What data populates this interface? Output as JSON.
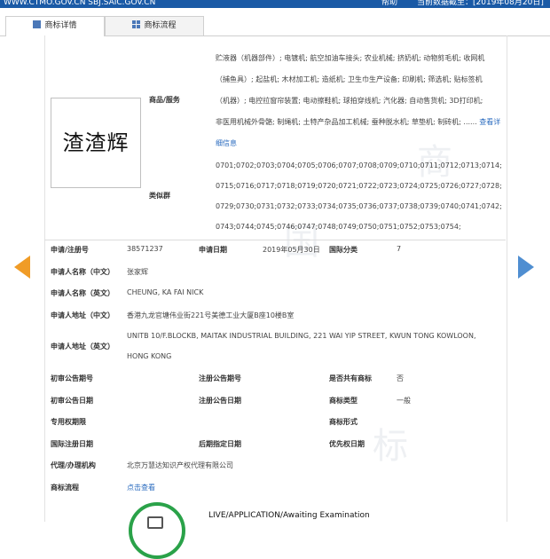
{
  "topbar": {
    "site": "WWW.CTMO.GOV.CN SBJ.SAIC.GOV.CN",
    "help": "帮助",
    "data_date": "当前数据截至：[2019年08月20日]"
  },
  "tabs": [
    {
      "label": "商标详情",
      "icon": "document-icon"
    },
    {
      "label": "商标流程",
      "icon": "grid-icon"
    }
  ],
  "trademark": {
    "logo_text": "渣渣辉",
    "goods_label": "商品/服务",
    "goods_lines": [
      "贮液器（机器部件）; 电镀机; 航空加油车接头; 农业机械; 挤奶机; 动物剪毛机; 收网机",
      "（捕鱼具）; 起盐机; 木材加工机; 造纸机; 卫生巾生产设备; 印刷机; 筛选机; 贴标签机",
      "（机器）; 电控拉窗帘装置; 电动擦鞋机; 球拍穿线机; 汽化器; 自动售货机; 3D打印机;",
      "非医用机械外骨骼; 制绳机; 土特产杂品加工机械; 蚕种脱水机; 草垫机; 制砖机; ......"
    ],
    "goods_more": "查看详细信息",
    "similar_label": "类似群",
    "similar_groups": "0701;0702;0703;0704;0705;0706;0707;0708;0709;0710;0711;0712;0713;0714;0715;0716;0717;0718;0719;0720;0721;0722;0723;0724;0725;0726;0727;0728;0729;0730;0731;0732;0733;0734;0735;0736;0737;0738;0739;0740;0741;0742;0743;0744;0745;0746;0747;0748;0749;0750;0751;0752;0753;0754;"
  },
  "fields": {
    "reg_no_label": "申请/注册号",
    "reg_no": "38571237",
    "apply_date_label": "申请日期",
    "apply_date": "2019年05月30日",
    "class_label": "国际分类",
    "class_value": "7",
    "name_cn_label": "申请人名称（中文）",
    "name_cn": "张家辉",
    "name_en_label": "申请人名称（英文）",
    "name_en": "CHEUNG, KA FAI NICK",
    "addr_cn_label": "申请人地址（中文）",
    "addr_cn": "香港九龙官塘伟业街221号美德工业大厦B座10楼B室",
    "addr_en_label": "申请人地址（英文）",
    "addr_en_1": "UNITB 10/F.BLOCKB, MAITAK INDUSTRIAL BUILDING, 221 WAI YIP STREET, KWUN TONG KOWLOON,",
    "addr_en_2": "HONG KONG",
    "prelim_no_label": "初审公告期号",
    "reg_pub_no_label": "注册公告期号",
    "shared_label": "是否共有商标",
    "shared_value": "否",
    "prelim_date_label": "初审公告日期",
    "reg_pub_date_label": "注册公告日期",
    "type_label": "商标类型",
    "type_value": "一般",
    "exclusive_label": "专用权期限",
    "form_label": "商标形式",
    "intl_reg_label": "国际注册日期",
    "later_label": "后期指定日期",
    "priority_label": "优先权日期",
    "agent_label": "代理/办理机构",
    "agent_value": "北京万慧达知识产权代理有限公司",
    "flow_label": "商标流程",
    "flow_link": "点击查看"
  },
  "status": {
    "text": "LIVE/APPLICATION/Awaiting Examination",
    "color": "#2aa249"
  },
  "watermark": [
    "中",
    "国",
    "商",
    "标"
  ],
  "nav": {
    "prev_color": "#f09c27",
    "next_color": "#4f8ed1"
  }
}
